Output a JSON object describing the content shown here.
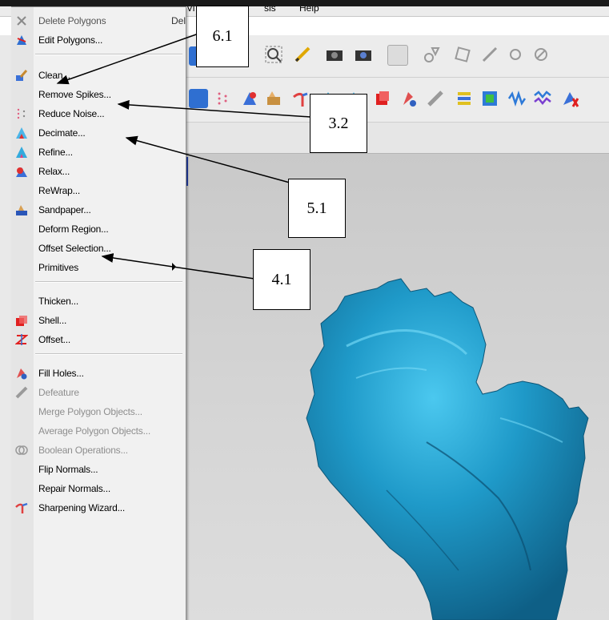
{
  "menubar": {
    "items": [
      "Vi",
      "sis",
      "Help"
    ]
  },
  "menu": {
    "items": [
      {
        "label": "Delete Polygons",
        "shortcut": "Del",
        "icon": "x-icon",
        "disabled": false
      },
      {
        "label": "Edit Polygons...",
        "icon": "edit-polygons-icon"
      },
      {
        "label": "Clean...",
        "icon": "clean-brush-icon"
      },
      {
        "label": "Remove Spikes...",
        "icon": ""
      },
      {
        "label": "Reduce Noise...",
        "icon": "reduce-noise-icon"
      },
      {
        "label": "Decimate...",
        "icon": "decimate-icon"
      },
      {
        "label": "Refine...",
        "icon": "refine-icon"
      },
      {
        "label": "Relax...",
        "icon": "relax-icon"
      },
      {
        "label": "ReWrap...",
        "icon": ""
      },
      {
        "label": "Sandpaper...",
        "icon": "sandpaper-icon"
      },
      {
        "label": "Deform Region...",
        "icon": ""
      },
      {
        "label": "Offset Selection...",
        "icon": ""
      },
      {
        "label": "Primitives",
        "icon": "",
        "submenu": true
      },
      {
        "label": "Thicken...",
        "icon": ""
      },
      {
        "label": "Shell...",
        "icon": "shell-icon"
      },
      {
        "label": "Offset...",
        "icon": "offset-icon"
      },
      {
        "label": "Fill Holes...",
        "icon": "fill-holes-icon"
      },
      {
        "label": "Defeature",
        "icon": "defeature-icon",
        "disabled": true
      },
      {
        "label": "Merge Polygon Objects...",
        "icon": "",
        "disabled": true
      },
      {
        "label": "Average Polygon Objects...",
        "icon": "",
        "disabled": true
      },
      {
        "label": "Boolean Operations...",
        "icon": "boolean-icon",
        "disabled": true
      },
      {
        "label": "Flip Normals...",
        "icon": ""
      },
      {
        "label": "Repair Normals...",
        "icon": ""
      },
      {
        "label": "Sharpening Wizard...",
        "icon": "sharpening-wizard-icon"
      }
    ]
  },
  "callouts": [
    "6.1",
    "3.2",
    "5.1",
    "4.1"
  ],
  "colors": {
    "mesh": "#1f9ac9",
    "menu_bg": "#f1f1f1",
    "viewport": "#d3d3d3"
  }
}
